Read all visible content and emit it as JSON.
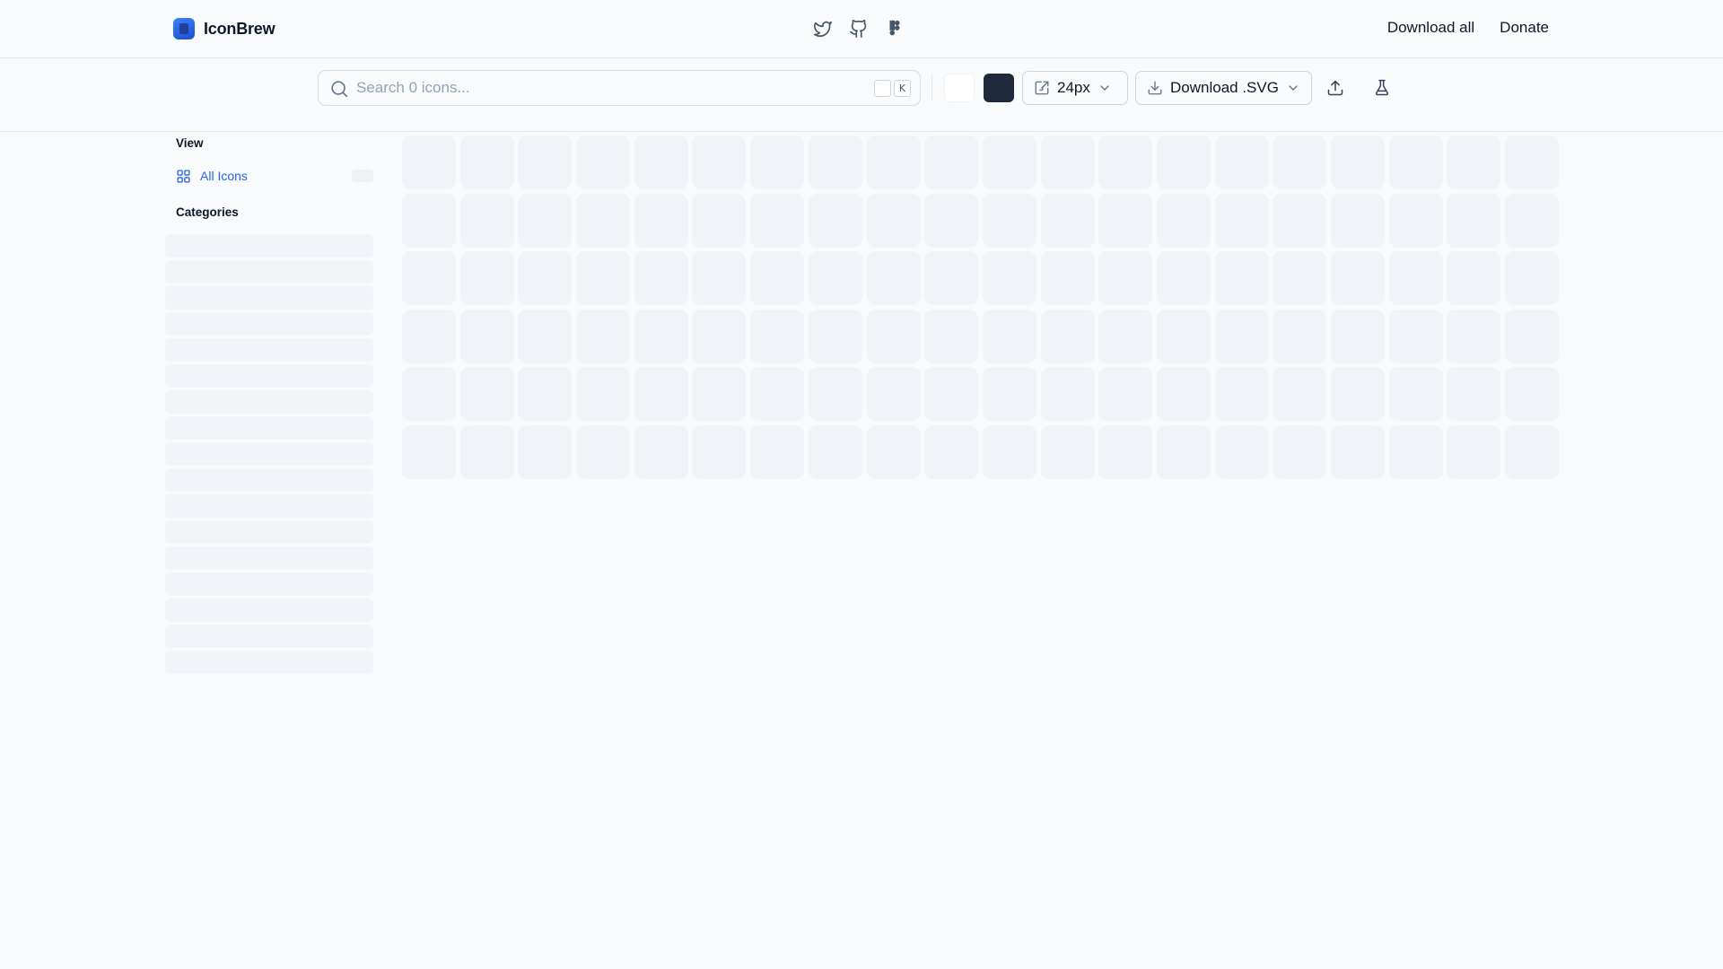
{
  "header": {
    "brand": "IconBrew",
    "social_icons": [
      "twitter-icon",
      "github-icon",
      "figma-icon"
    ],
    "nav": {
      "download_all": "Download all",
      "donate": "Donate"
    }
  },
  "toolbar": {
    "search_placeholder": "Search 0 icons...",
    "shortcut_keys": [
      "",
      "K"
    ],
    "colors": {
      "light": "#ffffff",
      "dark": "#1e293b"
    },
    "size_label": "24px",
    "download_label": "Download .SVG"
  },
  "sidebar": {
    "view_title": "View",
    "all_icons_label": "All Icons",
    "categories_title": "Categories",
    "category_placeholder_count": 17
  },
  "grid": {
    "columns": 20,
    "rows": 6
  },
  "colors": {
    "accent": "#2563eb",
    "text": "#0f172a",
    "muted": "#94a3b8"
  }
}
